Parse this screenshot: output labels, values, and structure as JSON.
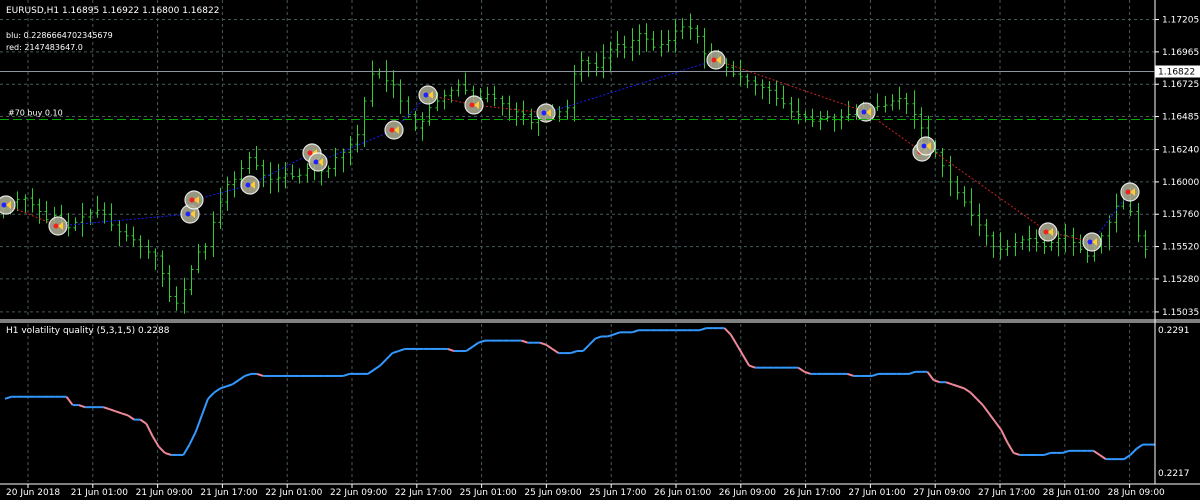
{
  "main_panel": {
    "header": "EURUSD,H1  1.16895 1.16922 1.16800 1.16822",
    "blu_label": "blu: 0.2286664702345679",
    "red_label": "red: 2147483647.0",
    "order_label": "#70 buy 0.10",
    "current_price_label": "1.16822"
  },
  "indicator_panel": {
    "header": "H1 volatility quality (5,3,1,5) 0.2288",
    "y_top_label": "0.2291",
    "y_bottom_label": "0.2217"
  },
  "colors": {
    "background": "#000000",
    "candle": "#33cc33",
    "grid": "#465a5a",
    "line_up": "#3399ff",
    "line_down": "#ee8899",
    "order_line": "#00aa00",
    "trend_blue": "#1a1aff",
    "trend_red": "#cc2222"
  },
  "chart_data": [
    {
      "type": "candlestick",
      "symbol": "EURUSD",
      "timeframe": "H1",
      "y_ticks": [
        1.17205,
        1.16965,
        1.16725,
        1.16485,
        1.1624,
        1.16,
        1.1576,
        1.1552,
        1.1528,
        1.15035
      ],
      "y_tick_labels": [
        "1.17205",
        "1.16965",
        "1.16725",
        "1.16485",
        "1.16240",
        "1.16000",
        "1.15760",
        "1.15520",
        "1.15280",
        "1.15035"
      ],
      "ylim": [
        1.1499,
        1.1735
      ],
      "x_tick_labels": [
        "20 Jun 2018",
        "21 Jun 01:00",
        "21 Jun 09:00",
        "21 Jun 17:00",
        "22 Jun 01:00",
        "22 Jun 09:00",
        "22 Jun 17:00",
        "25 Jun 01:00",
        "25 Jun 09:00",
        "25 Jun 17:00",
        "26 Jun 01:00",
        "26 Jun 09:00",
        "26 Jun 17:00",
        "27 Jun 01:00",
        "27 Jun 09:00",
        "27 Jun 17:00",
        "28 Jun 01:00",
        "28 Jun 09:00"
      ],
      "current_price": 1.16822,
      "order_level": 1.1647,
      "close": [
        1.158,
        1.1585,
        1.1587,
        1.1588,
        1.1583,
        1.1578,
        1.1572,
        1.1575,
        1.157,
        1.1566,
        1.157,
        1.1574,
        1.1577,
        1.1579,
        1.1576,
        1.1568,
        1.1563,
        1.156,
        1.1557,
        1.1552,
        1.1548,
        1.1545,
        1.1532,
        1.1515,
        1.151,
        1.152,
        1.1535,
        1.1548,
        1.1552,
        1.157,
        1.1585,
        1.1598,
        1.1602,
        1.161,
        1.1618,
        1.1612,
        1.1605,
        1.1602,
        1.1603,
        1.1606,
        1.1604,
        1.1605,
        1.161,
        1.1612,
        1.1608,
        1.161,
        1.1618,
        1.1622,
        1.1628,
        1.1635,
        1.166,
        1.168,
        1.1682,
        1.1675,
        1.1672,
        1.166,
        1.165,
        1.164,
        1.1645,
        1.1655,
        1.166,
        1.1664,
        1.1668,
        1.1672,
        1.1668,
        1.166,
        1.1662,
        1.1665,
        1.1662,
        1.1658,
        1.1654,
        1.1652,
        1.165,
        1.1644,
        1.1648,
        1.1652,
        1.1654,
        1.1652,
        1.1655,
        1.168,
        1.169,
        1.1688,
        1.1685,
        1.1692,
        1.1698,
        1.1702,
        1.17,
        1.1705,
        1.171,
        1.1706,
        1.17,
        1.1702,
        1.1705,
        1.1712,
        1.1715,
        1.1714,
        1.1708,
        1.1695,
        1.169,
        1.1688,
        1.1685,
        1.168,
        1.1678,
        1.1675,
        1.1672,
        1.167,
        1.1668,
        1.1662,
        1.1658,
        1.1652,
        1.165,
        1.1648,
        1.1645,
        1.1647,
        1.1648,
        1.1646,
        1.1648,
        1.165,
        1.1652,
        1.1654,
        1.1655,
        1.1656,
        1.1657,
        1.166,
        1.1662,
        1.1658,
        1.165,
        1.164,
        1.1628,
        1.1622,
        1.1612,
        1.16,
        1.1592,
        1.1585,
        1.1575,
        1.1568,
        1.156,
        1.1552,
        1.155,
        1.1552,
        1.1555,
        1.1557,
        1.1558,
        1.1555,
        1.1552,
        1.1555,
        1.1558,
        1.156,
        1.1555,
        1.155,
        1.1545,
        1.1552,
        1.156,
        1.157,
        1.1582,
        1.159,
        1.1578,
        1.156,
        1.155
      ]
    },
    {
      "type": "line",
      "name": "H1 volatility quality (5,3,1,5)",
      "ylim": [
        0.2216,
        0.2292
      ],
      "values": [
        0.2256,
        0.2257,
        0.2257,
        0.2257,
        0.2257,
        0.2257,
        0.2257,
        0.2257,
        0.2257,
        0.2257,
        0.2257,
        0.2253,
        0.2253,
        0.2252,
        0.2252,
        0.2252,
        0.2252,
        0.2251,
        0.225,
        0.2249,
        0.2248,
        0.2246,
        0.2246,
        0.2244,
        0.2238,
        0.2233,
        0.223,
        0.2229,
        0.2229,
        0.2229,
        0.2234,
        0.224,
        0.2248,
        0.2256,
        0.2259,
        0.2261,
        0.2262,
        0.2263,
        0.2265,
        0.2267,
        0.2268,
        0.2268,
        0.2267,
        0.2267,
        0.2267,
        0.2267,
        0.2267,
        0.2267,
        0.2267,
        0.2267,
        0.2267,
        0.2267,
        0.2267,
        0.2267,
        0.2267,
        0.2267,
        0.2268,
        0.2268,
        0.2268,
        0.2268,
        0.227,
        0.2272,
        0.2275,
        0.2278,
        0.2279,
        0.228,
        0.228,
        0.228,
        0.228,
        0.228,
        0.228,
        0.228,
        0.228,
        0.2279,
        0.2279,
        0.2279,
        0.2281,
        0.2283,
        0.2284,
        0.2284,
        0.2284,
        0.2284,
        0.2284,
        0.2284,
        0.2284,
        0.2283,
        0.2283,
        0.2283,
        0.2282,
        0.228,
        0.2278,
        0.2278,
        0.2278,
        0.2279,
        0.2279,
        0.2282,
        0.2285,
        0.2286,
        0.2286,
        0.2287,
        0.2288,
        0.2288,
        0.2288,
        0.2289,
        0.2289,
        0.2289,
        0.2289,
        0.2289,
        0.2289,
        0.2289,
        0.2289,
        0.2289,
        0.2289,
        0.2289,
        0.229,
        0.229,
        0.229,
        0.229,
        0.2287,
        0.2282,
        0.2277,
        0.2272,
        0.2271,
        0.2271,
        0.2271,
        0.2271,
        0.2271,
        0.2271,
        0.2271,
        0.2271,
        0.2269,
        0.2268,
        0.2268,
        0.2268,
        0.2268,
        0.2268,
        0.2268,
        0.2268,
        0.2267,
        0.2267,
        0.2267,
        0.2267,
        0.2268,
        0.2268,
        0.2268,
        0.2268,
        0.2268,
        0.2268,
        0.2269,
        0.2269,
        0.2269,
        0.2265,
        0.2264,
        0.2264,
        0.2263,
        0.2262,
        0.2261,
        0.2259,
        0.2256,
        0.2253,
        0.2249,
        0.2245,
        0.2241,
        0.2235,
        0.223,
        0.2229,
        0.2229,
        0.2229,
        0.2229,
        0.2229,
        0.223,
        0.223,
        0.223,
        0.2231,
        0.2231,
        0.2231,
        0.2231,
        0.2231,
        0.2229,
        0.2227,
        0.2227,
        0.2227,
        0.2227,
        0.2229,
        0.2232,
        0.2234,
        0.2234,
        0.2234
      ],
      "colors_by_direction": [
        "up",
        "down"
      ]
    }
  ]
}
